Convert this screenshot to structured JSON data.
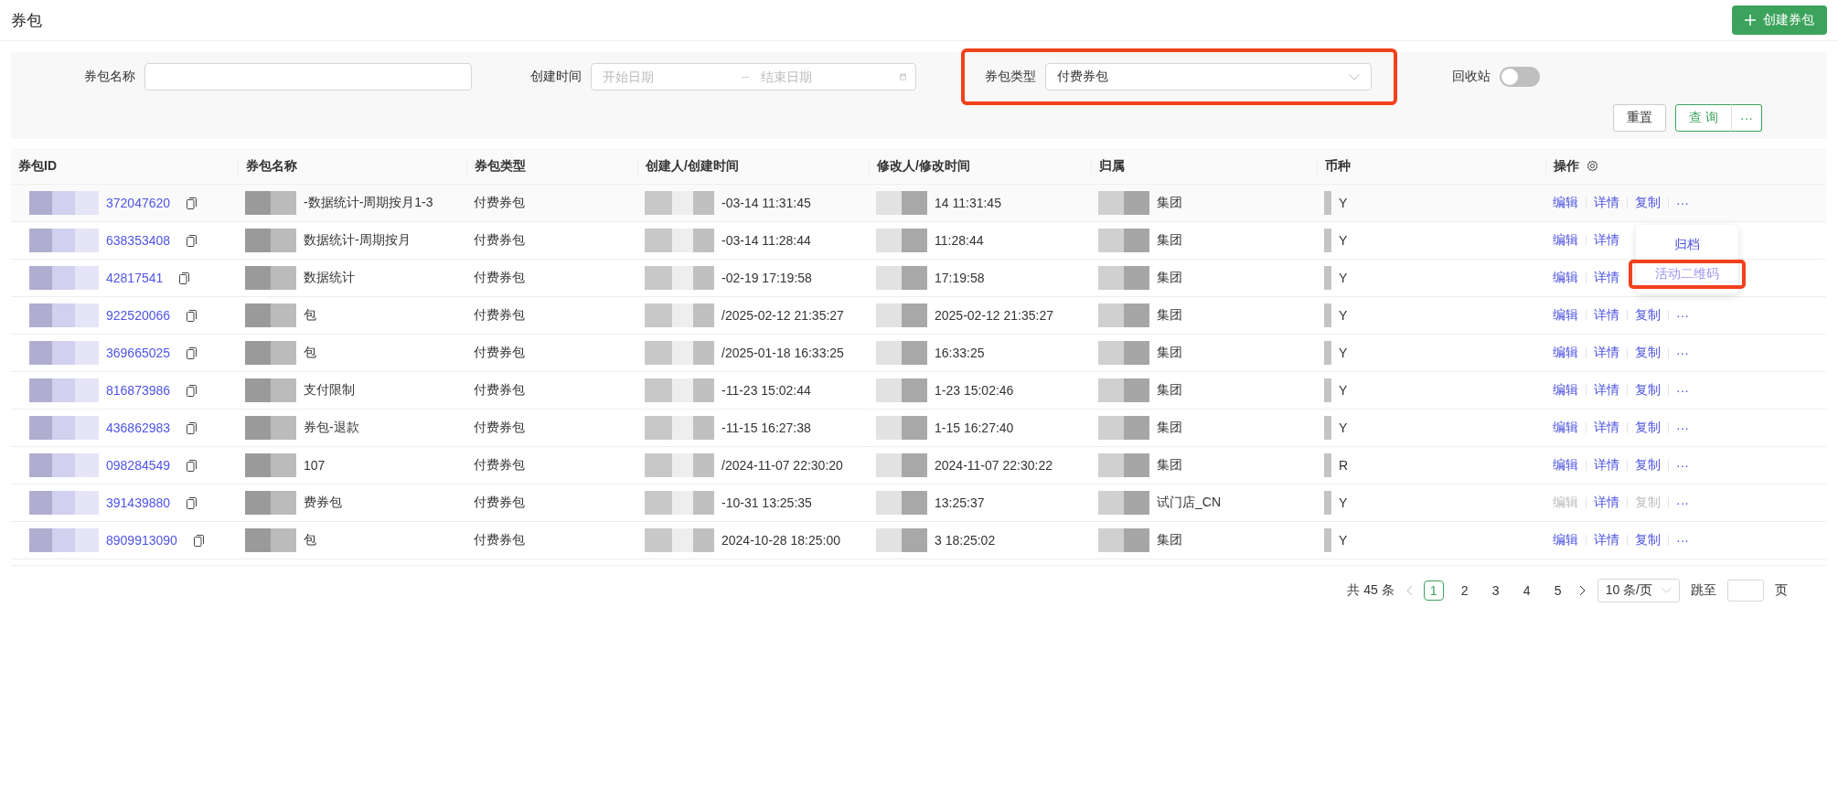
{
  "page": {
    "title": "券包",
    "create_button": "创建券包"
  },
  "filters": {
    "name_label": "券包名称",
    "time_label": "创建时间",
    "start_placeholder": "开始日期",
    "end_placeholder": "结束日期",
    "type_label": "券包类型",
    "type_value": "付费券包",
    "type_highlighted": true,
    "recycle_label": "回收站",
    "recycle_on": false,
    "reset": "重置",
    "query": "查 询",
    "more": "···"
  },
  "table": {
    "columns": [
      "券包ID",
      "券包名称",
      "券包类型",
      "创建人/创建时间",
      "修改人/修改时间",
      "归属",
      "币种",
      "操作"
    ],
    "rows": [
      {
        "id": "372047620",
        "name": "-数据统计-周期按月1-3",
        "type": "付费券包",
        "created": "-03-14 11:31:45",
        "modified": "14 11:31:45",
        "owner": "集团",
        "currency": "Y",
        "actions": [
          {
            "label": "编辑",
            "disabled": false
          },
          {
            "label": "详情",
            "disabled": false
          },
          {
            "label": "复制",
            "disabled": false
          },
          {
            "label": "···",
            "disabled": false
          }
        ]
      },
      {
        "id": "638353408",
        "name": "数据统计-周期按月",
        "type": "付费券包",
        "created": "-03-14 11:28:44",
        "modified": "11:28:44",
        "owner": "集团",
        "currency": "Y",
        "actions": [
          {
            "label": "编辑",
            "disabled": false
          },
          {
            "label": "详情",
            "disabled": false
          }
        ]
      },
      {
        "id": "42817541",
        "name": "数据统计",
        "type": "付费券包",
        "created": "-02-19 17:19:58",
        "modified": "17:19:58",
        "owner": "集团",
        "currency": "Y",
        "actions": [
          {
            "label": "编辑",
            "disabled": false
          },
          {
            "label": "详情",
            "disabled": false
          }
        ]
      },
      {
        "id": "922520066",
        "name": "包",
        "type": "付费券包",
        "created": "/2025-02-12 21:35:27",
        "modified": "2025-02-12 21:35:27",
        "owner": "集团",
        "currency": "Y",
        "actions": [
          {
            "label": "编辑",
            "disabled": false
          },
          {
            "label": "详情",
            "disabled": false
          },
          {
            "label": "复制",
            "disabled": false
          },
          {
            "label": "···",
            "disabled": false
          }
        ]
      },
      {
        "id": "369665025",
        "name": "包",
        "type": "付费券包",
        "created": "/2025-01-18 16:33:25",
        "modified": "16:33:25",
        "owner": "集团",
        "currency": "Y",
        "actions": [
          {
            "label": "编辑",
            "disabled": false
          },
          {
            "label": "详情",
            "disabled": false
          },
          {
            "label": "复制",
            "disabled": false
          },
          {
            "label": "···",
            "disabled": false
          }
        ]
      },
      {
        "id": "816873986",
        "name": "支付限制",
        "type": "付费券包",
        "created": "-11-23 15:02:44",
        "modified": "1-23 15:02:46",
        "owner": "集团",
        "currency": "Y",
        "actions": [
          {
            "label": "编辑",
            "disabled": false
          },
          {
            "label": "详情",
            "disabled": false
          },
          {
            "label": "复制",
            "disabled": false
          },
          {
            "label": "···",
            "disabled": false
          }
        ]
      },
      {
        "id": "436862983",
        "name": "券包-退款",
        "type": "付费券包",
        "created": "-11-15 16:27:38",
        "modified": "1-15 16:27:40",
        "owner": "集团",
        "currency": "Y",
        "actions": [
          {
            "label": "编辑",
            "disabled": false
          },
          {
            "label": "详情",
            "disabled": false
          },
          {
            "label": "复制",
            "disabled": false
          },
          {
            "label": "···",
            "disabled": false
          }
        ]
      },
      {
        "id": "098284549",
        "name": "107",
        "type": "付费券包",
        "created": "/2024-11-07 22:30:20",
        "modified": "2024-11-07 22:30:22",
        "owner": "集团",
        "currency": "R",
        "actions": [
          {
            "label": "编辑",
            "disabled": false
          },
          {
            "label": "详情",
            "disabled": false
          },
          {
            "label": "复制",
            "disabled": false
          },
          {
            "label": "···",
            "disabled": false
          }
        ]
      },
      {
        "id": "391439880",
        "name": "费券包",
        "type": "付费券包",
        "created": "-10-31 13:25:35",
        "modified": "13:25:37",
        "owner": "试门店_CN",
        "currency": "Y",
        "actions": [
          {
            "label": "编辑",
            "disabled": true
          },
          {
            "label": "详情",
            "disabled": false
          },
          {
            "label": "复制",
            "disabled": true
          },
          {
            "label": "···",
            "disabled": false
          }
        ]
      },
      {
        "id": "8909913090",
        "name": "包",
        "type": "付费券包",
        "created": "2024-10-28 18:25:00",
        "modified": "3 18:25:02",
        "owner": "集团",
        "currency": "Y",
        "actions": [
          {
            "label": "编辑",
            "disabled": false
          },
          {
            "label": "详情",
            "disabled": false
          },
          {
            "label": "复制",
            "disabled": false
          },
          {
            "label": "···",
            "disabled": false
          }
        ]
      }
    ]
  },
  "dropdown": {
    "items": [
      {
        "label": "归档",
        "hovered": false,
        "highlighted": false
      },
      {
        "label": "活动二维码",
        "hovered": true,
        "highlighted": true
      }
    ]
  },
  "pagination": {
    "total": "共 45 条",
    "pages": [
      {
        "label": "1",
        "selected": true
      },
      {
        "label": "2",
        "selected": false
      },
      {
        "label": "3",
        "selected": false
      },
      {
        "label": "4",
        "selected": false
      },
      {
        "label": "5",
        "selected": false
      }
    ],
    "page_size": "10 条/页",
    "jump_label": "跳至",
    "page_unit": "页"
  }
}
